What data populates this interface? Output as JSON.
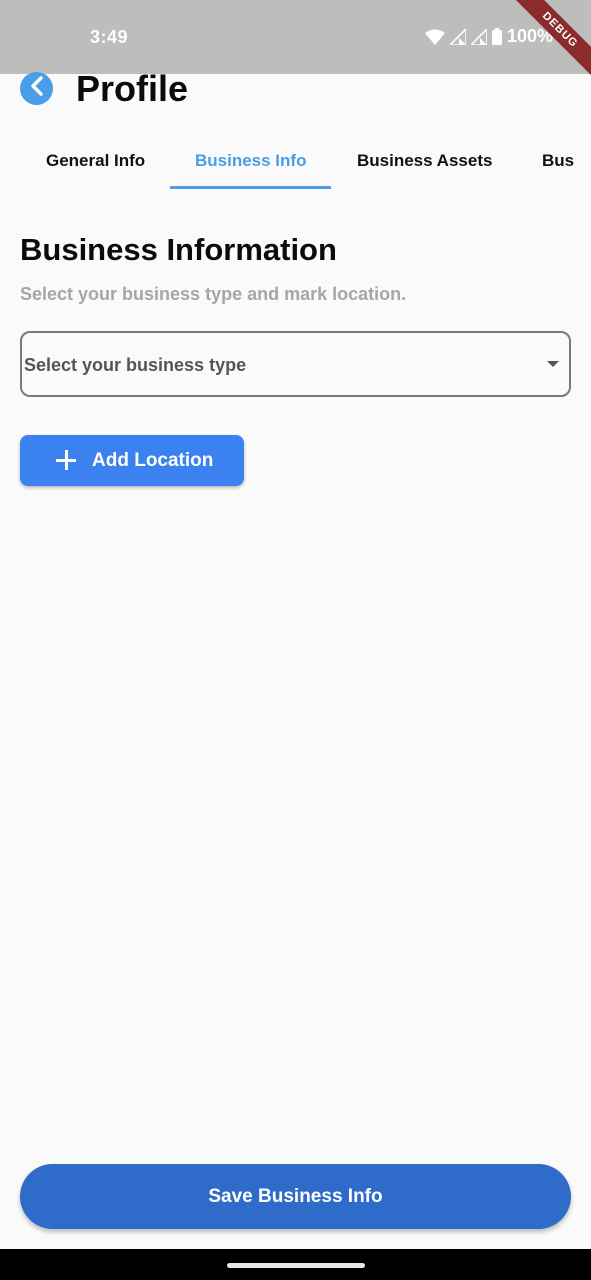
{
  "status_bar": {
    "time": "3:49",
    "battery": "100%",
    "icons": [
      "wifi-icon",
      "signal-icon",
      "signal-icon",
      "battery-icon"
    ]
  },
  "debug_banner": "DEBUG",
  "header": {
    "back_icon": "chevron-left-icon",
    "title": "Profile"
  },
  "tabs": [
    {
      "label": "General Info",
      "active": false
    },
    {
      "label": "Business Info",
      "active": true
    },
    {
      "label": "Business Assets",
      "active": false
    },
    {
      "label": "Bus",
      "active": false
    }
  ],
  "section": {
    "title": "Business Information",
    "subtitle": "Select your business type and mark location."
  },
  "business_type_select": {
    "placeholder": "Select your business type"
  },
  "add_location": {
    "label": "Add Location",
    "icon": "plus-icon"
  },
  "save_button": {
    "label": "Save Business Info"
  },
  "colors": {
    "accent": "#4a9de8",
    "primary_button": "#3b82f0",
    "save_button": "#2f6cc9",
    "status_bar": "#bdbdbd"
  }
}
